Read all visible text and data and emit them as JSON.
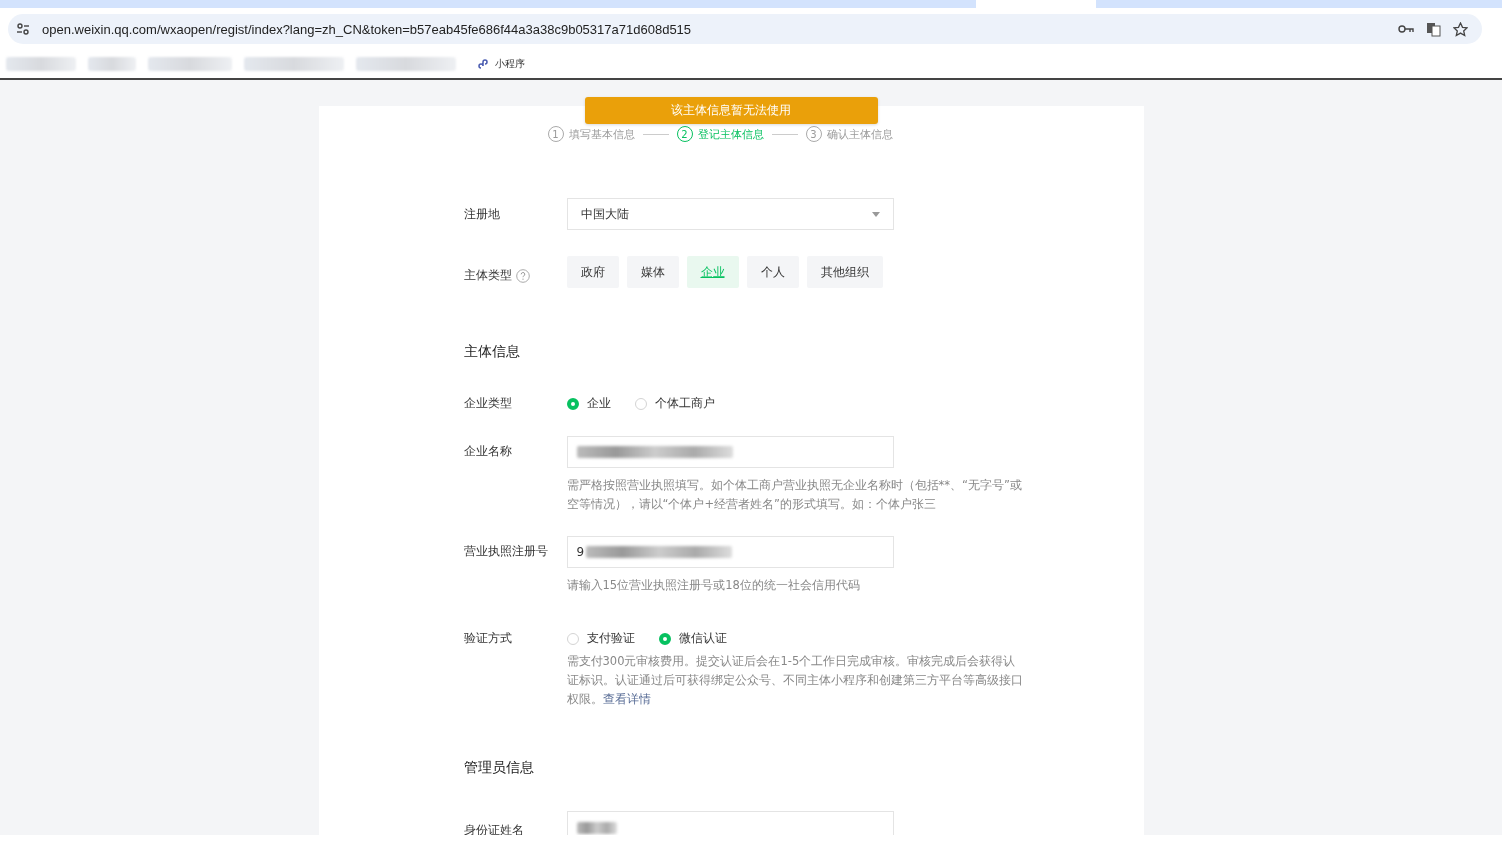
{
  "browser": {
    "url": "open.weixin.qq.com/wxaopen/regist/index?lang=zh_CN&token=b57eab45fe686f44a3a38c9b05317a71d608d515",
    "bookmarks": [
      {
        "label": "小程序"
      }
    ]
  },
  "toast": "该主体信息暂无法使用",
  "steps": [
    {
      "number": "1",
      "label": "填写基本信息",
      "selected": false
    },
    {
      "number": "2",
      "label": "登记主体信息",
      "selected": true
    },
    {
      "number": "3",
      "label": "确认主体信息",
      "selected": false
    }
  ],
  "region": {
    "label": "注册地",
    "value": "中国大陆"
  },
  "entity_type": {
    "label": "主体类型",
    "options": [
      {
        "label": "政府",
        "selected": false
      },
      {
        "label": "媒体",
        "selected": false
      },
      {
        "label": "企业",
        "selected": true
      },
      {
        "label": "个人",
        "selected": false
      },
      {
        "label": "其他组织",
        "selected": false
      }
    ]
  },
  "entity_info": {
    "title": "主体信息",
    "company_type": {
      "label": "企业类型",
      "options": [
        {
          "label": "企业",
          "selected": true
        },
        {
          "label": "个体工商户",
          "selected": false
        }
      ]
    },
    "company_name": {
      "label": "企业名称",
      "hint": "需严格按照营业执照填写。如个体工商户营业执照无企业名称时（包括**、“无字号”或空等情况），请以“个体户+经营者姓名”的形式填写。如：个体户张三"
    },
    "license_number": {
      "label": "营业执照注册号",
      "value": "9",
      "hint": "请输入15位营业执照注册号或18位的统一社会信用代码"
    },
    "verification": {
      "label": "验证方式",
      "options": [
        {
          "label": "支付验证",
          "selected": false
        },
        {
          "label": "微信认证",
          "selected": true
        }
      ],
      "description": "需支付300元审核费用。提交认证后会在1-5个工作日完成审核。审核完成后会获得认证标识。认证通过后可获得绑定公众号、不同主体小程序和创建第三方平台等高级接口权限。",
      "link": "查看详情"
    }
  },
  "admin_info": {
    "title": "管理员信息",
    "id_name": {
      "label": "身份证姓名"
    }
  }
}
